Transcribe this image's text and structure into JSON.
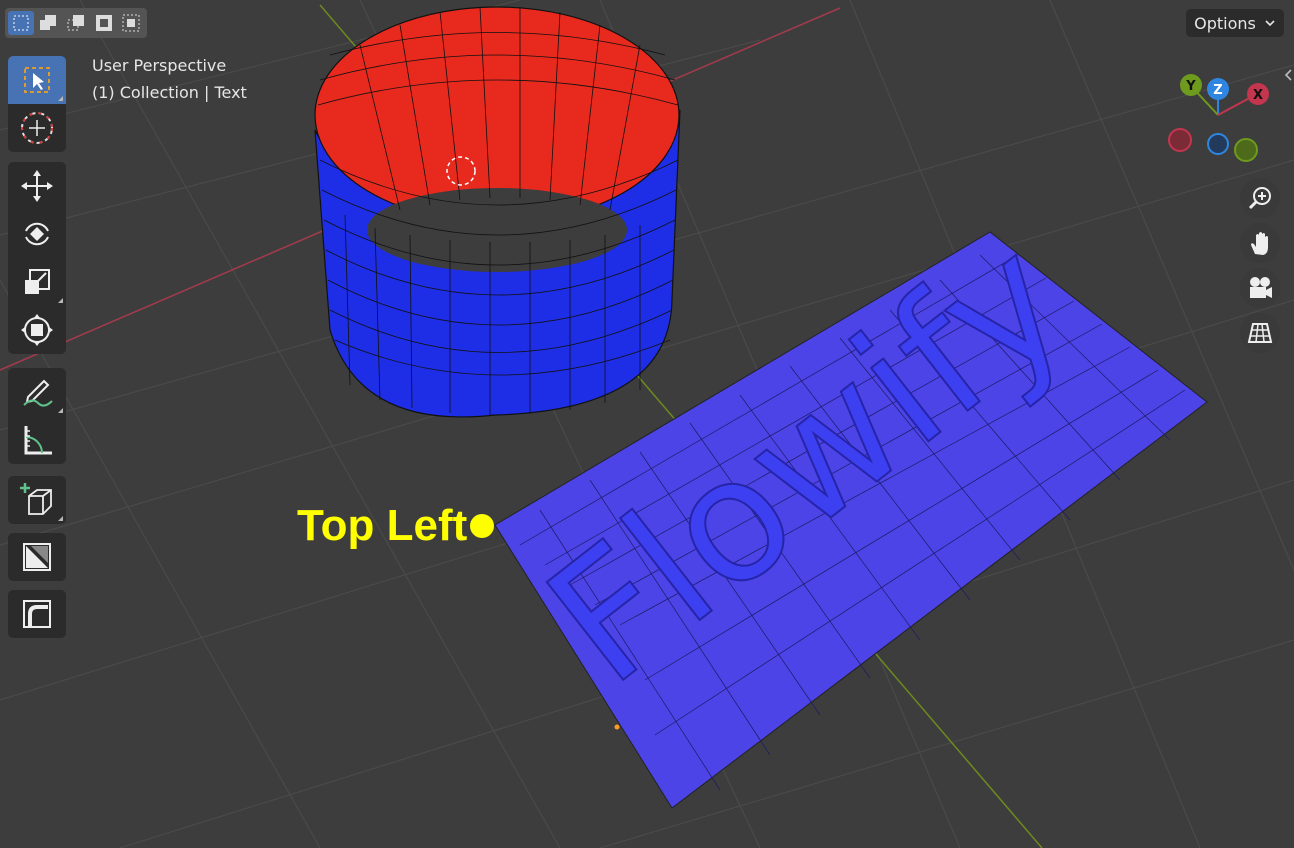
{
  "viewport": {
    "view_title": "User Perspective",
    "view_subtitle": "(1) Collection | Text"
  },
  "header": {
    "options_label": "Options",
    "selection_modes": [
      {
        "icon": "select-new-icon",
        "active": true
      },
      {
        "icon": "select-extend-icon",
        "active": false
      },
      {
        "icon": "select-subtract-icon",
        "active": false
      },
      {
        "icon": "select-invert-icon",
        "active": false
      },
      {
        "icon": "select-intersect-icon",
        "active": false
      }
    ]
  },
  "toolbar": [
    {
      "icon": "select-box-icon",
      "active": true
    },
    {
      "icon": "cursor-icon",
      "active": false
    },
    {
      "icon": "move-icon",
      "active": false
    },
    {
      "icon": "rotate-icon",
      "active": false
    },
    {
      "icon": "scale-icon",
      "active": false
    },
    {
      "icon": "transform-icon",
      "active": false
    },
    {
      "icon": "annotate-icon",
      "active": false
    },
    {
      "icon": "measure-icon",
      "active": false
    },
    {
      "icon": "add-cube-icon",
      "active": false
    },
    {
      "icon": "extrude-icon",
      "active": false
    },
    {
      "icon": "bevel-icon",
      "active": false
    }
  ],
  "gizmo": {
    "axis_y": "Y",
    "axis_z": "Z",
    "axis_x": "X",
    "colors": {
      "x": "#c4354e",
      "y": "#6e9a1e",
      "z": "#2f86e0"
    }
  },
  "navigation": [
    {
      "icon": "zoom-icon"
    },
    {
      "icon": "pan-hand-icon"
    },
    {
      "icon": "camera-icon"
    },
    {
      "icon": "ortho-grid-icon"
    }
  ],
  "scene": {
    "text_object": "Flowify",
    "annotation_label": "Top Left",
    "colors": {
      "cylinder_inside": "#e8291e",
      "cylinder_outside": "#1e2ee6",
      "plane": "#4c44e6",
      "annotation": "#ffff00"
    }
  }
}
